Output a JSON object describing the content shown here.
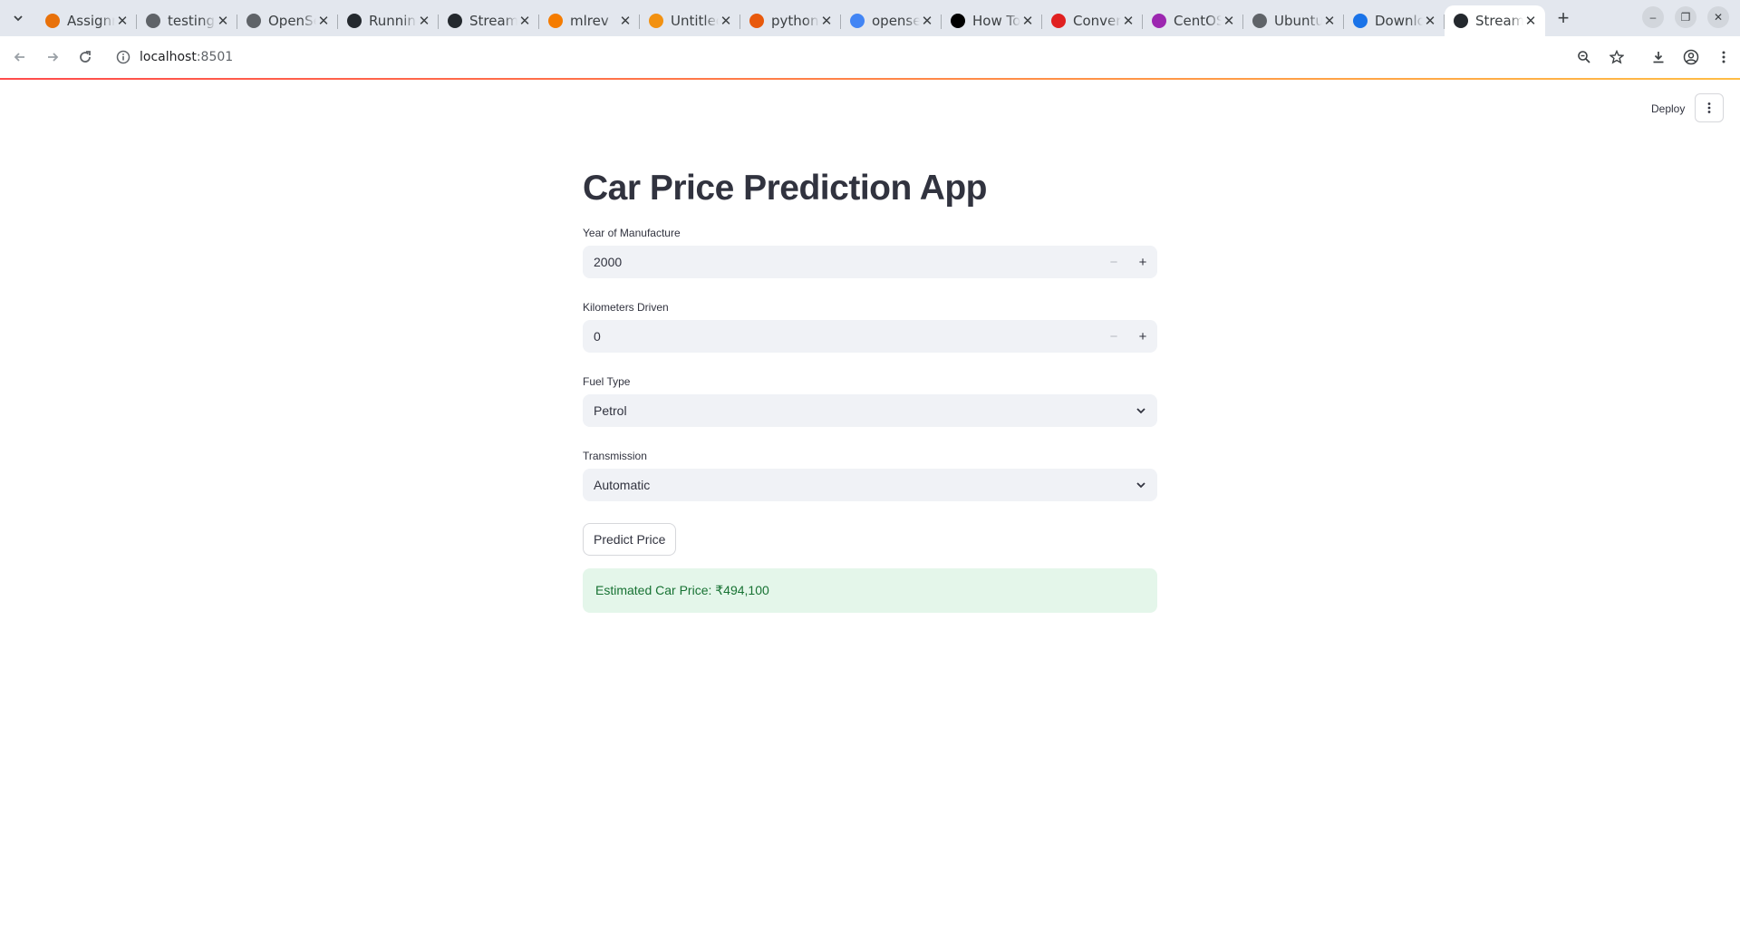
{
  "browser": {
    "tabs": [
      {
        "title": "Assignments",
        "favicon": "m-icon",
        "color": "#e8710a"
      },
      {
        "title": "testing",
        "favicon": "globe-icon",
        "color": "#5f6368"
      },
      {
        "title": "OpenSearch",
        "favicon": "globe-icon",
        "color": "#5f6368"
      },
      {
        "title": "Running",
        "favicon": "github-icon",
        "color": "#24292e"
      },
      {
        "title": "Streamlit",
        "favicon": "github-icon",
        "color": "#24292e"
      },
      {
        "title": "mlrev",
        "favicon": "loader-icon",
        "color": "#f57c00"
      },
      {
        "title": "Untitled",
        "favicon": "doc-icon",
        "color": "#f29111"
      },
      {
        "title": "python",
        "favicon": "ask-icon",
        "color": "#e8590c"
      },
      {
        "title": "opensearch",
        "favicon": "google-icon",
        "color": "#4285f4"
      },
      {
        "title": "How To",
        "favicon": "medium-icon",
        "color": "#000000"
      },
      {
        "title": "Convert",
        "favicon": "convert-icon",
        "color": "#e02020"
      },
      {
        "title": "CentOS",
        "favicon": "centos-icon",
        "color": "#9c27b0"
      },
      {
        "title": "Ubuntu",
        "favicon": "globe-icon",
        "color": "#5f6368"
      },
      {
        "title": "Download",
        "favicon": "download-icon",
        "color": "#1a73e8"
      },
      {
        "title": "Streamlit",
        "favicon": "github-icon",
        "color": "#24292e",
        "active": true
      }
    ],
    "url_host": "localhost",
    "url_port": ":8501"
  },
  "app": {
    "deploy_label": "Deploy",
    "title": "Car Price Prediction App",
    "year": {
      "label": "Year of Manufacture",
      "value": "2000"
    },
    "km": {
      "label": "Kilometers Driven",
      "value": "0"
    },
    "fuel": {
      "label": "Fuel Type",
      "value": "Petrol"
    },
    "transmission": {
      "label": "Transmission",
      "value": "Automatic"
    },
    "predict_label": "Predict Price",
    "result": "Estimated Car Price: ₹494,100"
  }
}
